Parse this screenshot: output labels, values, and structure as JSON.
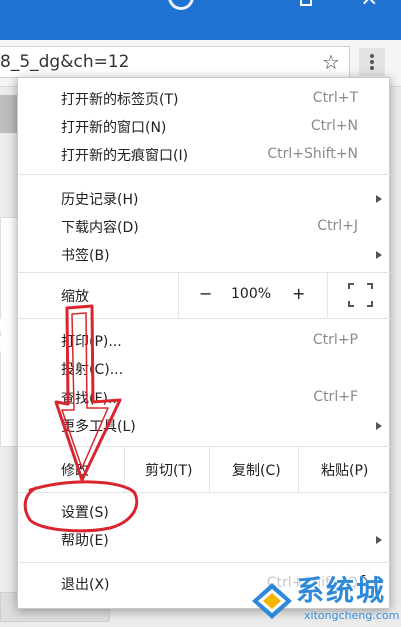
{
  "address_bar": {
    "url_fragment": "8_5_dg&ch=12"
  },
  "page_digit": "8",
  "menu": {
    "group1": [
      {
        "label": "打开新的标签页(T)",
        "shortcut": "Ctrl+T"
      },
      {
        "label": "打开新的窗口(N)",
        "shortcut": "Ctrl+N"
      },
      {
        "label": "打开新的无痕窗口(I)",
        "shortcut": "Ctrl+Shift+N"
      }
    ],
    "group2": [
      {
        "label": "历史记录(H)",
        "shortcut": ""
      },
      {
        "label": "下载内容(D)",
        "shortcut": "Ctrl+J"
      },
      {
        "label": "书签(B)",
        "shortcut": ""
      }
    ],
    "zoom": {
      "label": "缩放",
      "minus": "−",
      "value": "100%",
      "plus": "+"
    },
    "group3": [
      {
        "label": "打印(P)...",
        "shortcut": "Ctrl+P"
      },
      {
        "label": "投射(C)...",
        "shortcut": ""
      },
      {
        "label": "查找(F)...",
        "shortcut": "Ctrl+F"
      },
      {
        "label": "更多工具(L)",
        "shortcut": ""
      }
    ],
    "edit": {
      "label": "修改",
      "cut": "剪切(T)",
      "copy": "复制(C)",
      "paste": "粘贴(P)"
    },
    "group4": [
      {
        "label": "设置(S)",
        "shortcut": ""
      },
      {
        "label": "帮助(E)",
        "shortcut": ""
      }
    ],
    "exit": {
      "label": "退出(X)",
      "shortcut": "Ctrl+Shift+Q"
    }
  },
  "watermark": {
    "text": "系统城",
    "url": "xitongcheng.com"
  },
  "colors": {
    "annotation": "#d9262e",
    "titlebar": "#1e73d1",
    "watermark": "#2e8ad8"
  }
}
